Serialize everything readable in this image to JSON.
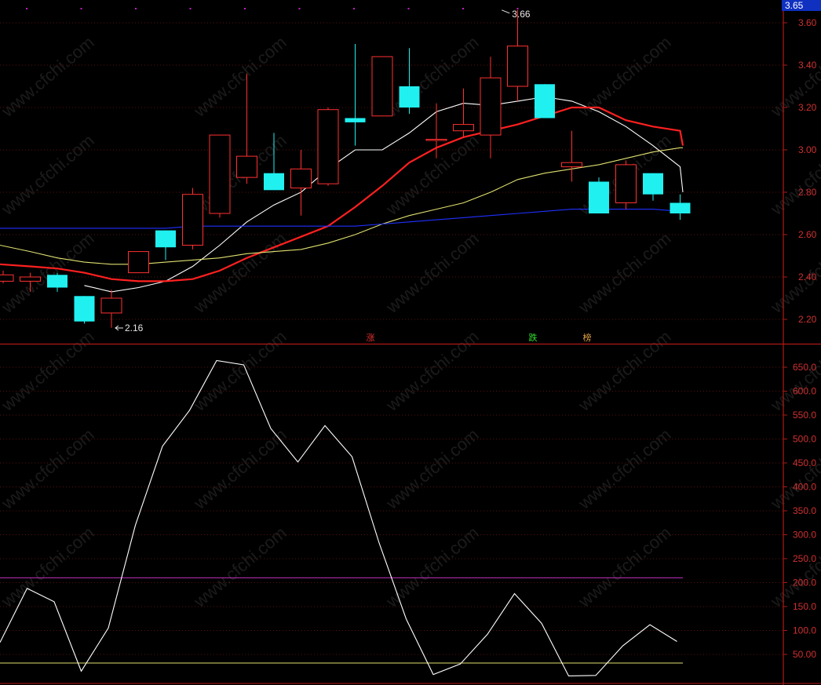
{
  "chart_data": [
    {
      "type": "candlestick",
      "price_label": "3.65",
      "ylim": [
        2.1,
        3.7
      ],
      "ticks": [
        "3.60",
        "3.40",
        "3.20",
        "3.00",
        "2.80",
        "2.60",
        "2.40",
        "2.20"
      ],
      "tick_values": [
        3.6,
        3.4,
        3.2,
        3.0,
        2.8,
        2.6,
        2.4,
        2.2
      ],
      "high_annotation": {
        "label": "3.66",
        "bar_index": 18
      },
      "low_annotation": {
        "label": "2.16",
        "bar_index": 3
      },
      "candles": [
        {
          "o": 2.38,
          "h": 2.43,
          "l": 2.37,
          "c": 2.41
        },
        {
          "o": 2.38,
          "h": 2.42,
          "l": 2.33,
          "c": 2.4
        },
        {
          "o": 2.41,
          "h": 2.42,
          "l": 2.33,
          "c": 2.35
        },
        {
          "o": 2.31,
          "h": 2.31,
          "l": 2.18,
          "c": 2.19
        },
        {
          "o": 2.23,
          "h": 2.34,
          "l": 2.16,
          "c": 2.3
        },
        {
          "o": 2.42,
          "h": 2.52,
          "l": 2.42,
          "c": 2.52
        },
        {
          "o": 2.62,
          "h": 2.62,
          "l": 2.48,
          "c": 2.54
        },
        {
          "o": 2.55,
          "h": 2.82,
          "l": 2.53,
          "c": 2.79
        },
        {
          "o": 2.7,
          "h": 3.07,
          "l": 2.68,
          "c": 3.07
        },
        {
          "o": 2.87,
          "h": 3.36,
          "l": 2.84,
          "c": 2.97
        },
        {
          "o": 2.89,
          "h": 3.08,
          "l": 2.81,
          "c": 2.81
        },
        {
          "o": 2.82,
          "h": 3.0,
          "l": 2.69,
          "c": 2.91
        },
        {
          "o": 2.84,
          "h": 3.2,
          "l": 2.83,
          "c": 3.19
        },
        {
          "o": 3.15,
          "h": 3.5,
          "l": 3.02,
          "c": 3.13
        },
        {
          "o": 3.16,
          "h": 3.44,
          "l": 3.16,
          "c": 3.44
        },
        {
          "o": 3.3,
          "h": 3.48,
          "l": 3.17,
          "c": 3.2
        },
        {
          "o": 3.05,
          "h": 3.22,
          "l": 2.96,
          "c": 3.05
        },
        {
          "o": 3.09,
          "h": 3.29,
          "l": 3.06,
          "c": 3.12
        },
        {
          "o": 3.07,
          "h": 3.44,
          "l": 2.96,
          "c": 3.34
        },
        {
          "o": 3.3,
          "h": 3.66,
          "l": 3.23,
          "c": 3.49
        },
        {
          "o": 3.31,
          "h": 3.31,
          "l": 3.15,
          "c": 3.15
        },
        {
          "o": 2.92,
          "h": 3.09,
          "l": 2.85,
          "c": 2.94
        },
        {
          "o": 2.85,
          "h": 2.87,
          "l": 2.7,
          "c": 2.7
        },
        {
          "o": 2.75,
          "h": 2.95,
          "l": 2.72,
          "c": 2.93
        },
        {
          "o": 2.89,
          "h": 2.89,
          "l": 2.76,
          "c": 2.79
        },
        {
          "o": 2.75,
          "h": 2.79,
          "l": 2.67,
          "c": 2.7
        }
      ],
      "ma_lines": [
        {
          "color": "#ffffff",
          "values": [
            null,
            null,
            null,
            2.36,
            2.33,
            2.35,
            2.38,
            2.45,
            2.55,
            2.66,
            2.74,
            2.8,
            2.91,
            3.0,
            3.0,
            3.08,
            3.18,
            3.22,
            3.21,
            3.23,
            3.25,
            3.23,
            3.18,
            3.11,
            3.02,
            2.92,
            2.8
          ]
        },
        {
          "color": "#ff2020",
          "values": [
            2.46,
            2.45,
            2.44,
            2.42,
            2.39,
            2.38,
            2.38,
            2.39,
            2.43,
            2.49,
            2.54,
            2.59,
            2.64,
            2.73,
            2.83,
            2.94,
            3.01,
            3.06,
            3.09,
            3.12,
            3.16,
            3.2,
            3.2,
            3.14,
            3.11,
            3.09,
            3.02
          ]
        },
        {
          "color": "#e0e070",
          "values": [
            2.55,
            2.52,
            2.49,
            2.47,
            2.46,
            2.46,
            2.47,
            2.48,
            2.49,
            2.51,
            2.52,
            2.53,
            2.56,
            2.6,
            2.65,
            2.69,
            2.72,
            2.75,
            2.8,
            2.86,
            2.89,
            2.91,
            2.93,
            2.96,
            2.99,
            3.01,
            3.01
          ]
        },
        {
          "color": "#2030ff",
          "values": [
            2.63,
            2.63,
            2.63,
            2.63,
            2.63,
            2.63,
            2.63,
            2.64,
            2.64,
            2.64,
            2.64,
            2.64,
            2.64,
            2.64,
            2.65,
            2.66,
            2.67,
            2.68,
            2.69,
            2.7,
            2.71,
            2.72,
            2.72,
            2.72,
            2.72,
            2.71,
            2.71
          ]
        }
      ],
      "markers": [
        {
          "label": "涨",
          "bar_index": 13,
          "color": "#e03030"
        },
        {
          "label": "跌",
          "bar_index": 19,
          "color": "#30e030"
        },
        {
          "label": "榜",
          "bar_index": 21,
          "color": "#e0a040"
        }
      ]
    },
    {
      "type": "line",
      "ylim": [
        15,
        690
      ],
      "ticks": [
        "650.0",
        "600.0",
        "550.0",
        "500.0",
        "450.0",
        "400.0",
        "350.0",
        "300.0",
        "250.0",
        "200.0",
        "150.0",
        "100.0",
        "50.00"
      ],
      "tick_values": [
        650,
        600,
        550,
        500,
        450,
        400,
        350,
        300,
        250,
        200,
        150,
        100,
        50
      ],
      "series": [
        {
          "color": "#ffffff",
          "values": [
            75,
            188,
            160,
            15,
            105,
            320,
            485,
            560,
            664,
            655,
            522,
            452,
            528,
            463,
            283,
            124,
            8,
            30,
            92,
            177,
            115,
            5,
            6,
            68,
            112,
            77
          ]
        }
      ],
      "hlines": [
        {
          "value": 210,
          "color": "#c030c0"
        },
        {
          "value": 32,
          "color": "#e0e070"
        }
      ]
    }
  ],
  "watermark": "www.cfchi.com"
}
